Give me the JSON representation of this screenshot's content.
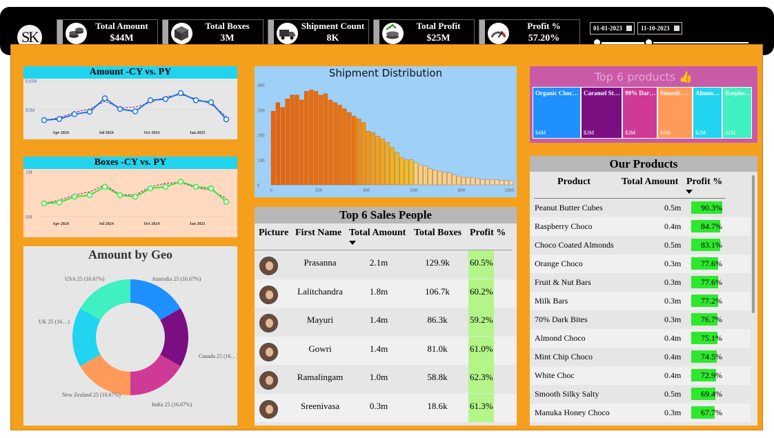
{
  "logo": "SK",
  "kpis": [
    {
      "label": "Total Amount",
      "value": "$44M",
      "icon": "coins-icon"
    },
    {
      "label": "Total Boxes",
      "value": "3M",
      "icon": "box-icon"
    },
    {
      "label": "Shipment Count",
      "value": "8K",
      "icon": "truck-icon"
    },
    {
      "label": "Total Profit",
      "value": "$25M",
      "icon": "money-icon"
    },
    {
      "label": "Profit %",
      "value": "57.20%",
      "icon": "gauge-icon"
    }
  ],
  "date_filter": {
    "start": "01-01-2023",
    "end": "11-10-2023"
  },
  "amount_chart": {
    "title": "Amount -CY vs. PY",
    "y_ticks": [
      "$10M",
      "$5M"
    ],
    "x_ticks": [
      "Apr 2024",
      "Jul 2024",
      "Oct 2024",
      "Jan 2025"
    ],
    "colors": {
      "cy": "#1a73e8",
      "py": "#8b1a6b"
    },
    "cy": [
      1.0,
      1.3,
      2.5,
      3.1,
      6.5,
      3.8,
      3.2,
      6.0,
      6.3,
      7.8,
      6.0,
      5.5,
      1.2
    ],
    "py": [
      1.0,
      1.6,
      3.0,
      3.8,
      5.7,
      4.1,
      4.3,
      5.4,
      6.9,
      7.4,
      6.4,
      5.0,
      2.0
    ]
  },
  "boxes_chart": {
    "title": "Boxes -CY vs. PY",
    "y_ticks": [
      "1M",
      "0M"
    ],
    "x_ticks": [
      "Apr 2024",
      "Jul 2024",
      "Oct 2024",
      "Jan 2025"
    ],
    "colors": {
      "cy": "#39e639",
      "py": "#8b1a6b"
    },
    "cy": [
      0.35,
      0.38,
      0.55,
      0.6,
      0.85,
      0.6,
      0.55,
      0.8,
      0.85,
      1.0,
      0.85,
      0.8,
      0.4
    ],
    "py": [
      0.35,
      0.45,
      0.6,
      0.7,
      0.9,
      0.62,
      0.6,
      0.85,
      0.95,
      0.98,
      0.82,
      0.75,
      0.5
    ]
  },
  "geo_chart": {
    "title": "Amount by Geo",
    "slices": [
      {
        "label": "Australia 25 (16.67%)",
        "value": 16.67,
        "color": "#1e90ff"
      },
      {
        "label": "Canada 25 (16…)",
        "value": 16.67,
        "color": "#7a0f82"
      },
      {
        "label": "India 25 (16.67%)",
        "value": 16.67,
        "color": "#cf3a96"
      },
      {
        "label": "New Zealand 25 (16.67%)",
        "value": 16.67,
        "color": "#ff9a5a"
      },
      {
        "label": "UK 25 (16…)",
        "value": 16.67,
        "color": "#22d4ef"
      },
      {
        "label": "USA 25 (16.67%)",
        "value": 16.67,
        "color": "#3ff0c0"
      }
    ]
  },
  "chart_data": {
    "type": "bar",
    "title": "Shipment Distribution",
    "xlabel": "",
    "ylabel": "",
    "x_ticks": [
      0,
      200,
      400,
      600,
      800,
      1000
    ],
    "y_ticks": [
      0,
      100,
      200,
      300,
      400
    ],
    "xlim": [
      0,
      1000
    ],
    "ylim": [
      0,
      420
    ],
    "bin_width": 20,
    "values": [
      295,
      330,
      310,
      345,
      360,
      360,
      340,
      375,
      380,
      375,
      360,
      365,
      340,
      330,
      320,
      305,
      290,
      275,
      265,
      250,
      215,
      210,
      195,
      185,
      170,
      150,
      130,
      110,
      100,
      100,
      90,
      80,
      75,
      65,
      60,
      55,
      50,
      48,
      40,
      35,
      30,
      30,
      28,
      25,
      22,
      20,
      22,
      20,
      18,
      18,
      16
    ]
  },
  "sales_people": {
    "title": "Top 6 Sales People",
    "headers": [
      "Picture",
      "First Name",
      "Total Amount",
      "Total Boxes",
      "Profit %"
    ],
    "rows": [
      {
        "name": "Prasanna",
        "amount": "2.1m",
        "boxes": "129.9k",
        "profit": "60.5%"
      },
      {
        "name": "Lalitchandra",
        "amount": "1.8m",
        "boxes": "106.7k",
        "profit": "60.2%"
      },
      {
        "name": "Mayuri",
        "amount": "1.4m",
        "boxes": "86.3k",
        "profit": "59.2%"
      },
      {
        "name": "Gowri",
        "amount": "1.4m",
        "boxes": "81.0k",
        "profit": "61.0%"
      },
      {
        "name": "Ramalingam",
        "amount": "1.0m",
        "boxes": "58.8k",
        "profit": "62.3%"
      },
      {
        "name": "Sreenivasa",
        "amount": "0.3m",
        "boxes": "18.6k",
        "profit": "61.3%"
      }
    ]
  },
  "top_products": {
    "title": "Top 6 products 👍",
    "tiles": [
      {
        "name": "Organic Choc…",
        "value": "$4M",
        "color": "#1e90ff"
      },
      {
        "name": "Caramel St…",
        "value": "$3M",
        "color": "#7a0f82"
      },
      {
        "name": "99% Dar…",
        "value": "$3M",
        "color": "#cf3a96"
      },
      {
        "name": "Smooth …",
        "value": "$3M",
        "color": "#ff9a5a"
      },
      {
        "name": "Almon…",
        "value": "$2M",
        "color": "#22d4ef"
      },
      {
        "name": "Rasphe…",
        "value": "$2M",
        "color": "#3ff0c0"
      }
    ]
  },
  "our_products": {
    "title": "Our Products",
    "headers": [
      "Product",
      "Total Amount",
      "Profit %"
    ],
    "rows": [
      {
        "name": "Peanut Butter Cubes",
        "amount": "0.5m",
        "profit": "90.3%",
        "p": 90.3
      },
      {
        "name": "Raspberry Choco",
        "amount": "0.4m",
        "profit": "84.7%",
        "p": 84.7
      },
      {
        "name": "Choco Coated Almonds",
        "amount": "0.5m",
        "profit": "83.1%",
        "p": 83.1
      },
      {
        "name": "Orange Choco",
        "amount": "0.3m",
        "profit": "77.6%",
        "p": 77.6
      },
      {
        "name": "Fruit & Nut Bars",
        "amount": "0.3m",
        "profit": "77.6%",
        "p": 77.6
      },
      {
        "name": "Milk Bars",
        "amount": "0.3m",
        "profit": "77.2%",
        "p": 77.2
      },
      {
        "name": "70% Dark Bites",
        "amount": "0.3m",
        "profit": "76.7%",
        "p": 76.7
      },
      {
        "name": "Almond Choco",
        "amount": "0.4m",
        "profit": "75.1%",
        "p": 75.1
      },
      {
        "name": "Mint Chip Choco",
        "amount": "0.4m",
        "profit": "74.5%",
        "p": 74.5
      },
      {
        "name": "White Choc",
        "amount": "0.4m",
        "profit": "72.9%",
        "p": 72.9
      },
      {
        "name": "Smooth Silky Salty",
        "amount": "0.5m",
        "profit": "69.4%",
        "p": 69.4
      },
      {
        "name": "Manuka Honey Choco",
        "amount": "0.3m",
        "profit": "67.7%",
        "p": 67.7
      }
    ]
  }
}
